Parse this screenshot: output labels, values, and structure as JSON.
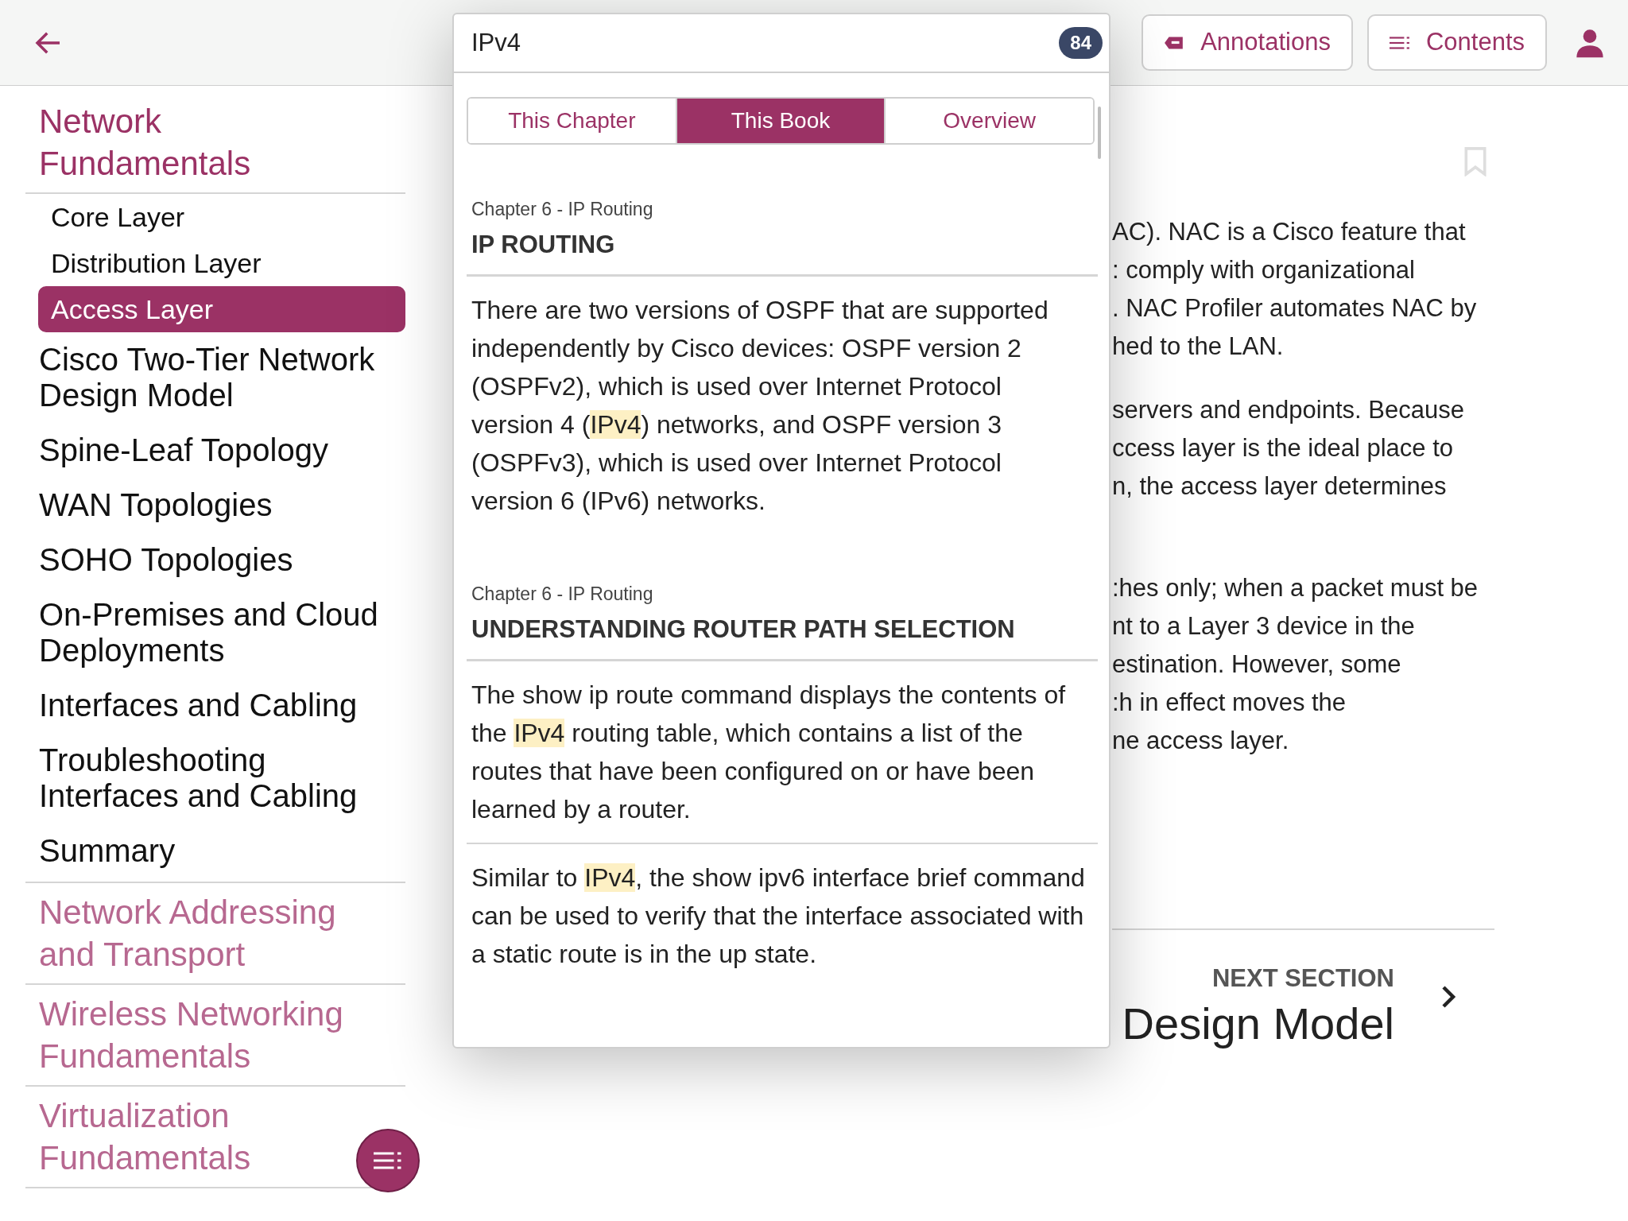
{
  "top_bar": {
    "annotations_button": "Annotations",
    "contents_button": "Contents"
  },
  "search": {
    "value": "IPv4",
    "result_count": "84",
    "tabs": [
      {
        "label": "This Chapter",
        "selected": false
      },
      {
        "label": "This Book",
        "selected": true
      },
      {
        "label": "Overview",
        "selected": false
      }
    ],
    "results": [
      {
        "breadcrumb": "Chapter 6 - IP Routing",
        "title": "IP ROUTING",
        "snippets": [
          [
            {
              "text": "There are two versions of OSPF that are supported independently by Cisco devices: OSPF version 2 (OSPFv2), which is used over Internet Protocol version 4 (",
              "highlight": false
            },
            {
              "text": "IPv4",
              "highlight": true
            },
            {
              "text": ") networks, and OSPF version 3 (OSPFv3), which is used over Internet Protocol version 6 (IPv6) networks.",
              "highlight": false
            }
          ]
        ]
      },
      {
        "breadcrumb": "Chapter 6 - IP Routing",
        "title": "UNDERSTANDING ROUTER PATH SELECTION",
        "snippets": [
          [
            {
              "text": "The show ip route command displays the contents of the ",
              "highlight": false
            },
            {
              "text": "IPv4",
              "highlight": true
            },
            {
              "text": " routing table, which contains a list of the routes that have been configured on or have been learned by a router.",
              "highlight": false
            }
          ],
          [
            {
              "text": "Similar to ",
              "highlight": false
            },
            {
              "text": "IPv4",
              "highlight": true
            },
            {
              "text": ", the show ipv6 interface brief command can be used to verify that the interface associated with a static route is in the up state.",
              "highlight": false
            }
          ]
        ]
      }
    ]
  },
  "sidebar": {
    "chapters": [
      {
        "title": "Network Fundamentals",
        "expanded": true,
        "items": [
          {
            "kind": "subsection",
            "title": "Core Layer",
            "selected": false
          },
          {
            "kind": "subsection",
            "title": "Distribution Layer",
            "selected": false
          },
          {
            "kind": "subsection",
            "title": "Access Layer",
            "selected": true
          },
          {
            "kind": "section",
            "title": "Cisco Two-Tier Network Design Model",
            "selected": false
          },
          {
            "kind": "section",
            "title": "Spine-Leaf Topology",
            "selected": false
          },
          {
            "kind": "section",
            "title": "WAN Topologies",
            "selected": false
          },
          {
            "kind": "section",
            "title": "SOHO Topologies",
            "selected": false
          },
          {
            "kind": "section",
            "title": "On-Premises and Cloud Deployments",
            "selected": false
          },
          {
            "kind": "section",
            "title": "Interfaces and Cabling",
            "selected": false
          },
          {
            "kind": "section",
            "title": "Troubleshooting Interfaces and Cabling",
            "selected": false
          },
          {
            "kind": "section",
            "title": "Summary",
            "selected": false
          }
        ]
      },
      {
        "title": "Network Addressing and Transport",
        "expanded": false
      },
      {
        "title": "Wireless Networking Fundamentals",
        "expanded": false
      },
      {
        "title": "Virtualization Fundamentals",
        "expanded": false
      }
    ]
  },
  "article": {
    "paragraphs": [
      [
        "AC). NAC is a Cisco feature that",
        ": comply with organizational",
        ". NAC Profiler automates NAC by",
        "hed to the LAN."
      ],
      [
        "servers and endpoints. Because",
        "ccess layer is the ideal place to",
        "n, the access layer determines"
      ],
      [
        ":hes only; when a packet must be",
        "nt to a Layer 3 device in the",
        "estination. However, some",
        ":h in effect moves the",
        "ne access layer."
      ]
    ],
    "next_section": {
      "label": "NEXT SECTION",
      "title": "Design Model"
    }
  }
}
